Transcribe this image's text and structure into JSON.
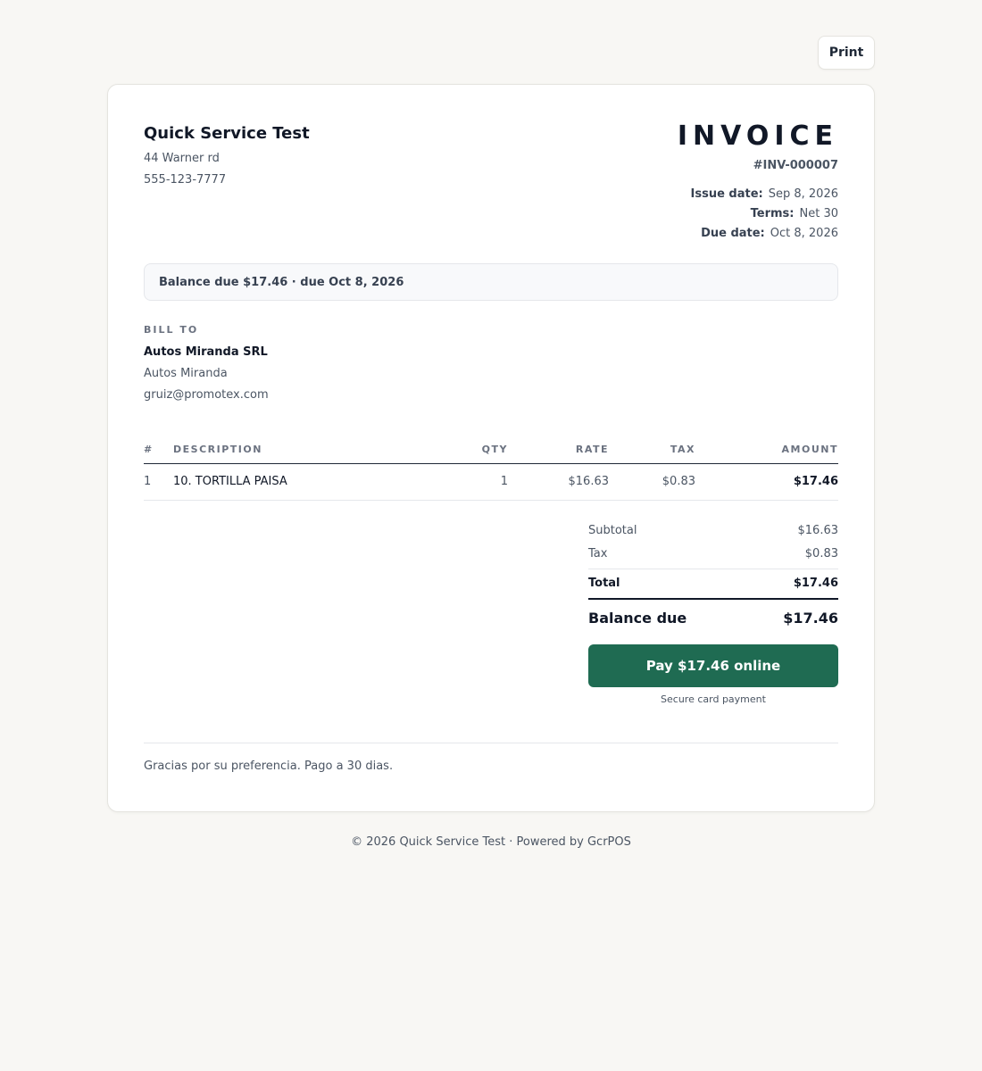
{
  "toolbar": {
    "print_label": "Print"
  },
  "business": {
    "name": "Quick Service Test",
    "address": "44 Warner rd",
    "phone": "555-123-7777"
  },
  "invoice": {
    "title": "INVOICE",
    "number": "#INV-000007",
    "issue_label": "Issue date:",
    "issue_date": "Sep 8, 2026",
    "terms_label": "Terms:",
    "terms": "Net 30",
    "due_label": "Due date:",
    "due_date": "Oct 8, 2026"
  },
  "banner": {
    "text": "Balance due $17.46 · due Oct 8, 2026"
  },
  "bill_to": {
    "label": "BILL TO",
    "company": "Autos Miranda SRL",
    "contact": "Autos Miranda",
    "email": "gruiz@promotex.com"
  },
  "table": {
    "headers": {
      "num": "#",
      "description": "DESCRIPTION",
      "qty": "QTY",
      "rate": "RATE",
      "tax": "TAX",
      "amount": "AMOUNT"
    },
    "rows": [
      {
        "num": "1",
        "description": "10. TORTILLA PAISA",
        "qty": "1",
        "rate": "$16.63",
        "tax": "$0.83",
        "amount": "$17.46"
      }
    ]
  },
  "totals": {
    "subtotal_label": "Subtotal",
    "subtotal": "$16.63",
    "tax_label": "Tax",
    "tax": "$0.83",
    "total_label": "Total",
    "total": "$17.46",
    "balance_label": "Balance due",
    "balance": "$17.46"
  },
  "payment": {
    "button_label": "Pay $17.46 online",
    "note": "Secure card payment",
    "accent_color": "#1f6b52"
  },
  "footer": {
    "note": "Gracias por su preferencia. Pago a 30 dias.",
    "copyright": "© 2026 Quick Service Test · Powered by GcrPOS"
  }
}
